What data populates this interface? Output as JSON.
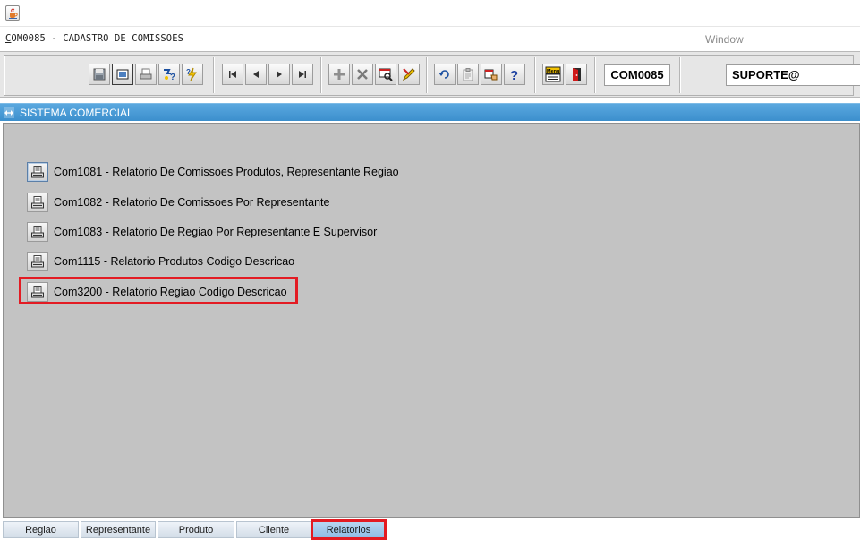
{
  "window": {
    "title": "COM0085 - CADASTRO DE COMISSOES",
    "title_first_letter": "C",
    "title_rest": "OM0085 - CADASTRO DE COMISSOES",
    "window_menu": "Window",
    "app_icon": "java-cup-icon"
  },
  "toolbar": {
    "groups": [
      [
        "save-icon",
        "screen-icon",
        "print-icon",
        "help-query-icon",
        "lightning-query-icon"
      ],
      [
        "first-record-icon",
        "prev-record-icon",
        "next-record-icon",
        "last-record-icon"
      ],
      [
        "insert-record-icon",
        "delete-record-icon",
        "search-record-icon",
        "edit-record-icon"
      ],
      [
        "undo-icon",
        "clipboard-icon",
        "hand-point-icon",
        "question-icon"
      ],
      [
        "menu-icon",
        "exit-door-icon"
      ]
    ],
    "form_code": "COM0085",
    "user": "SUPORTE@"
  },
  "system_bar": {
    "title": "SISTEMA COMERCIAL",
    "icon": "expand-arrows-icon"
  },
  "reports": [
    {
      "label": "Com1081 - Relatorio De Comissoes Produtos, Representante Regiao",
      "icon": "report-print-icon"
    },
    {
      "label": "Com1082 - Relatorio De Comissoes Por Representante",
      "icon": "report-print-icon"
    },
    {
      "label": "Com1083 - Relatorio De Regiao Por Representante E Supervisor",
      "icon": "report-print-icon"
    },
    {
      "label": "Com1115 - Relatorio Produtos Codigo Descricao",
      "icon": "report-print-icon"
    },
    {
      "label": "Com3200 - Relatorio Regiao Codigo Descricao",
      "icon": "report-print-icon"
    }
  ],
  "highlighted_report_index": 4,
  "tabs": [
    {
      "label": "Regiao"
    },
    {
      "label": "Representante"
    },
    {
      "label": "Produto"
    },
    {
      "label": "Cliente"
    },
    {
      "label": "Relatorios"
    }
  ],
  "selected_tab": "Relatorios",
  "colors": {
    "highlight": "#e31b23",
    "system_bar": "#3c8fcd",
    "panel": "#c3c3c3"
  }
}
